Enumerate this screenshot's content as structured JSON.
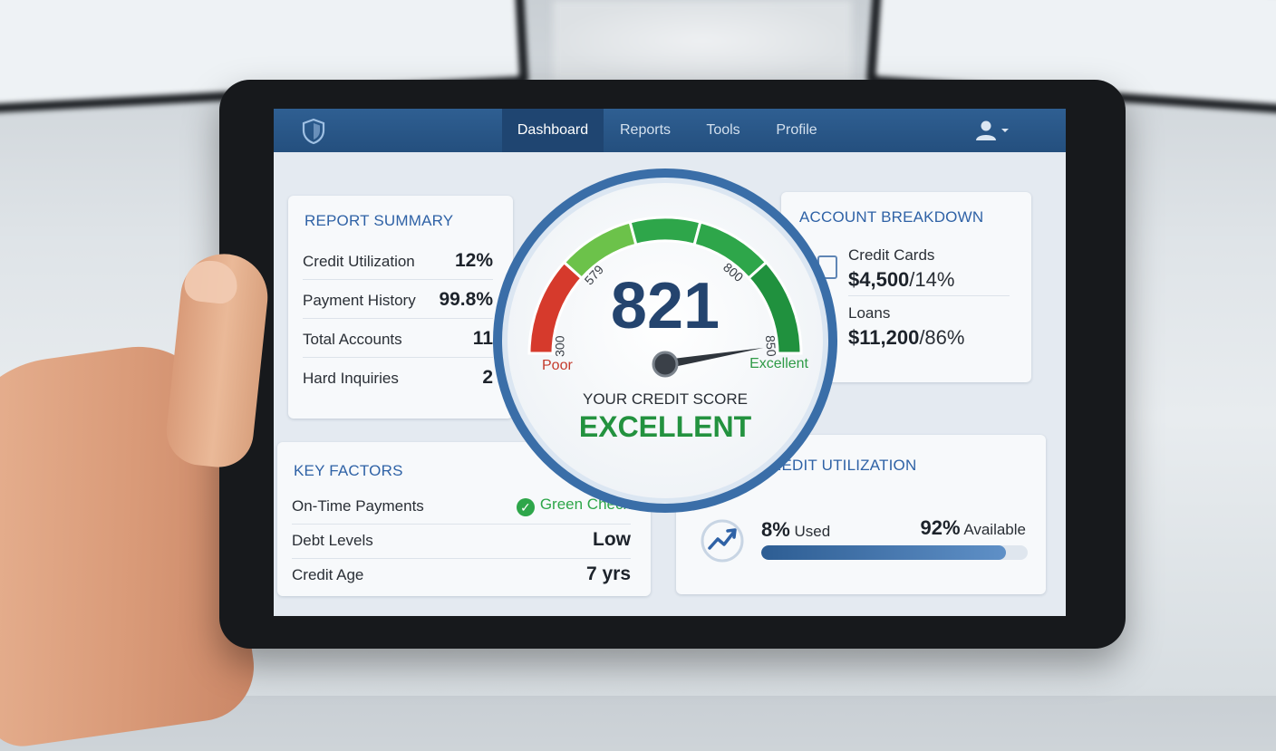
{
  "nav": {
    "tabs": [
      "Dashboard",
      "Reports",
      "Tools",
      "Profile"
    ],
    "active_tab": "Dashboard",
    "icons": {
      "logo": "shield-icon",
      "user": "user-icon",
      "user_menu": "chevron-down-icon"
    },
    "colors": {
      "bar": "#2a5687",
      "active": "#1f4571"
    }
  },
  "report_summary": {
    "title": "REPORT SUMMARY",
    "rows": [
      {
        "label": "Credit Utilization",
        "value": "12%"
      },
      {
        "label": "Payment History",
        "value": "99.8%"
      },
      {
        "label": "Total Accounts",
        "value": "11"
      },
      {
        "label": "Hard Inquiries",
        "value": "2"
      }
    ]
  },
  "key_factors": {
    "title": "KEY FACTORS",
    "rows": [
      {
        "label": "On-Time Payments",
        "value": "Green Check",
        "icon": "check-circle-icon"
      },
      {
        "label": "Debt Levels",
        "value": "Low"
      },
      {
        "label": "Credit Age",
        "value": "7 yrs"
      }
    ]
  },
  "account_breakdown": {
    "title": "ACCOUNT BREAKDOWN",
    "icon": "credit-card-icon",
    "items": [
      {
        "name": "Credit Cards",
        "amount": "$4,500",
        "percent": "/14%"
      },
      {
        "name": "Loans",
        "amount": "$11,200",
        "percent": "/86%"
      }
    ]
  },
  "credit_utilization": {
    "title": "REDIT UTILIZATION",
    "icon": "trend-up-icon",
    "used_value": "8%",
    "used_label": "Used",
    "available_value": "92%",
    "available_label": "Available",
    "bar_fill_fraction": 0.92
  },
  "gauge": {
    "score": "821",
    "score_value": 821,
    "min": 300,
    "max": 850,
    "tick_labels": [
      "300",
      "579",
      "800",
      "850"
    ],
    "low_label": "Poor",
    "high_label": "Excellent",
    "caption": "YOUR CREDIT SCORE",
    "rating": "EXCELLENT",
    "colors": {
      "ring": "#3b6fa8",
      "red": "#d63a2c",
      "light_green": "#6cc24a",
      "green": "#2ea64a",
      "dark_green": "#20913e",
      "score_text": "#24446e",
      "rating_text": "#23923f"
    }
  }
}
